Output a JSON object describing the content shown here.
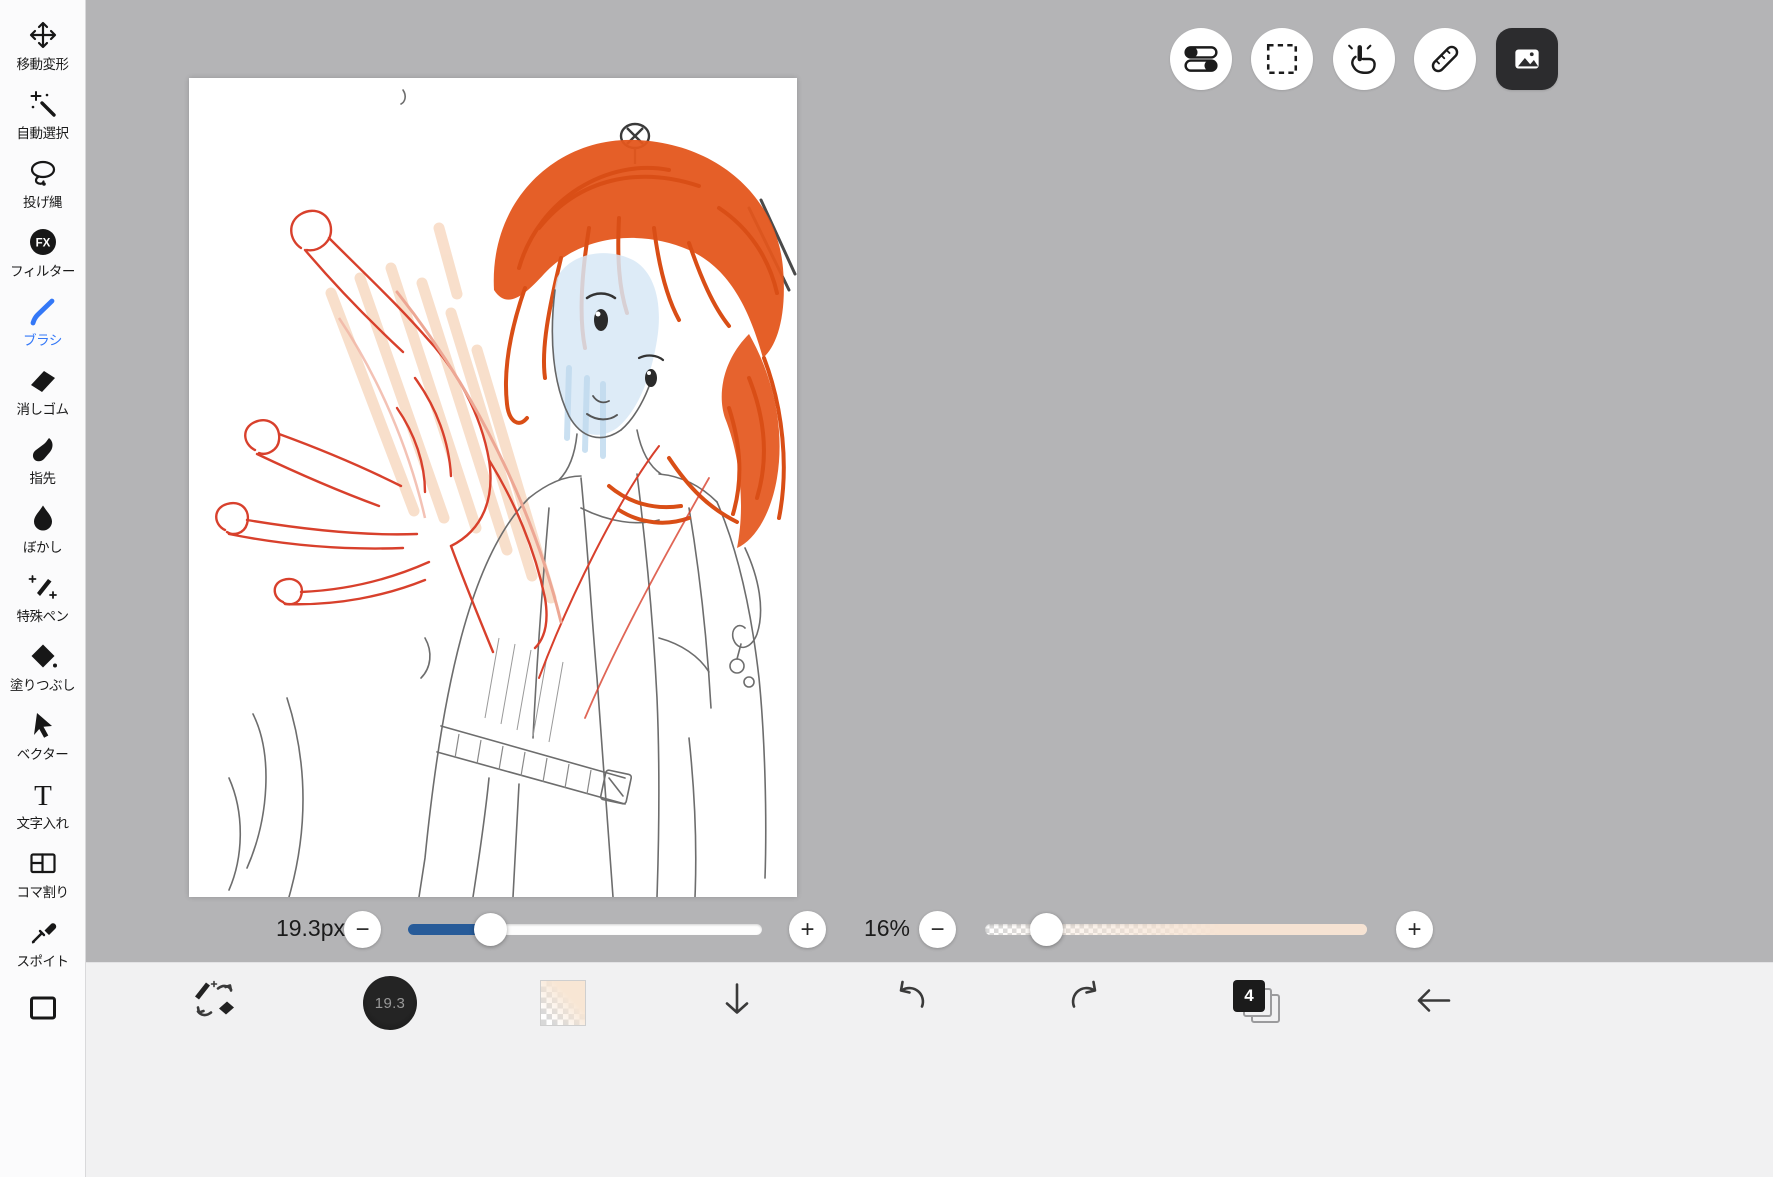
{
  "colors": {
    "accent_blue": "#3478f7",
    "slider_blue": "#275b99",
    "canvas_bg": "#b4b4b6",
    "peach": "#f6e3d3"
  },
  "sidebar": {
    "items": [
      {
        "id": "move-transform",
        "label": "移動変形"
      },
      {
        "id": "auto-select",
        "label": "自動選択"
      },
      {
        "id": "lasso",
        "label": "投げ縄"
      },
      {
        "id": "filter",
        "label": "フィルター"
      },
      {
        "id": "brush",
        "label": "ブラシ",
        "active": true
      },
      {
        "id": "eraser",
        "label": "消しゴム"
      },
      {
        "id": "fingertip",
        "label": "指先"
      },
      {
        "id": "blur",
        "label": "ぼかし"
      },
      {
        "id": "special-pen",
        "label": "特殊ペン"
      },
      {
        "id": "bucket-fill",
        "label": "塗りつぶし"
      },
      {
        "id": "vector",
        "label": "ベクター"
      },
      {
        "id": "text-insert",
        "label": "文字入れ"
      },
      {
        "id": "panel-divide",
        "label": "コマ割り"
      },
      {
        "id": "eyedropper",
        "label": "スポイト"
      }
    ]
  },
  "glyphs": {
    "fx": "FX",
    "text_tool": "T",
    "minus": "−",
    "plus": "+"
  },
  "top_toolbar": {
    "buttons": [
      {
        "name": "tool-property"
      },
      {
        "name": "selection"
      },
      {
        "name": "gesture"
      },
      {
        "name": "ruler"
      },
      {
        "name": "material"
      }
    ]
  },
  "controls": {
    "brush_size": "19.3px",
    "opacity": "16%"
  },
  "bottom_bar": {
    "brush_preview": "19.3",
    "layer_count": "4"
  }
}
